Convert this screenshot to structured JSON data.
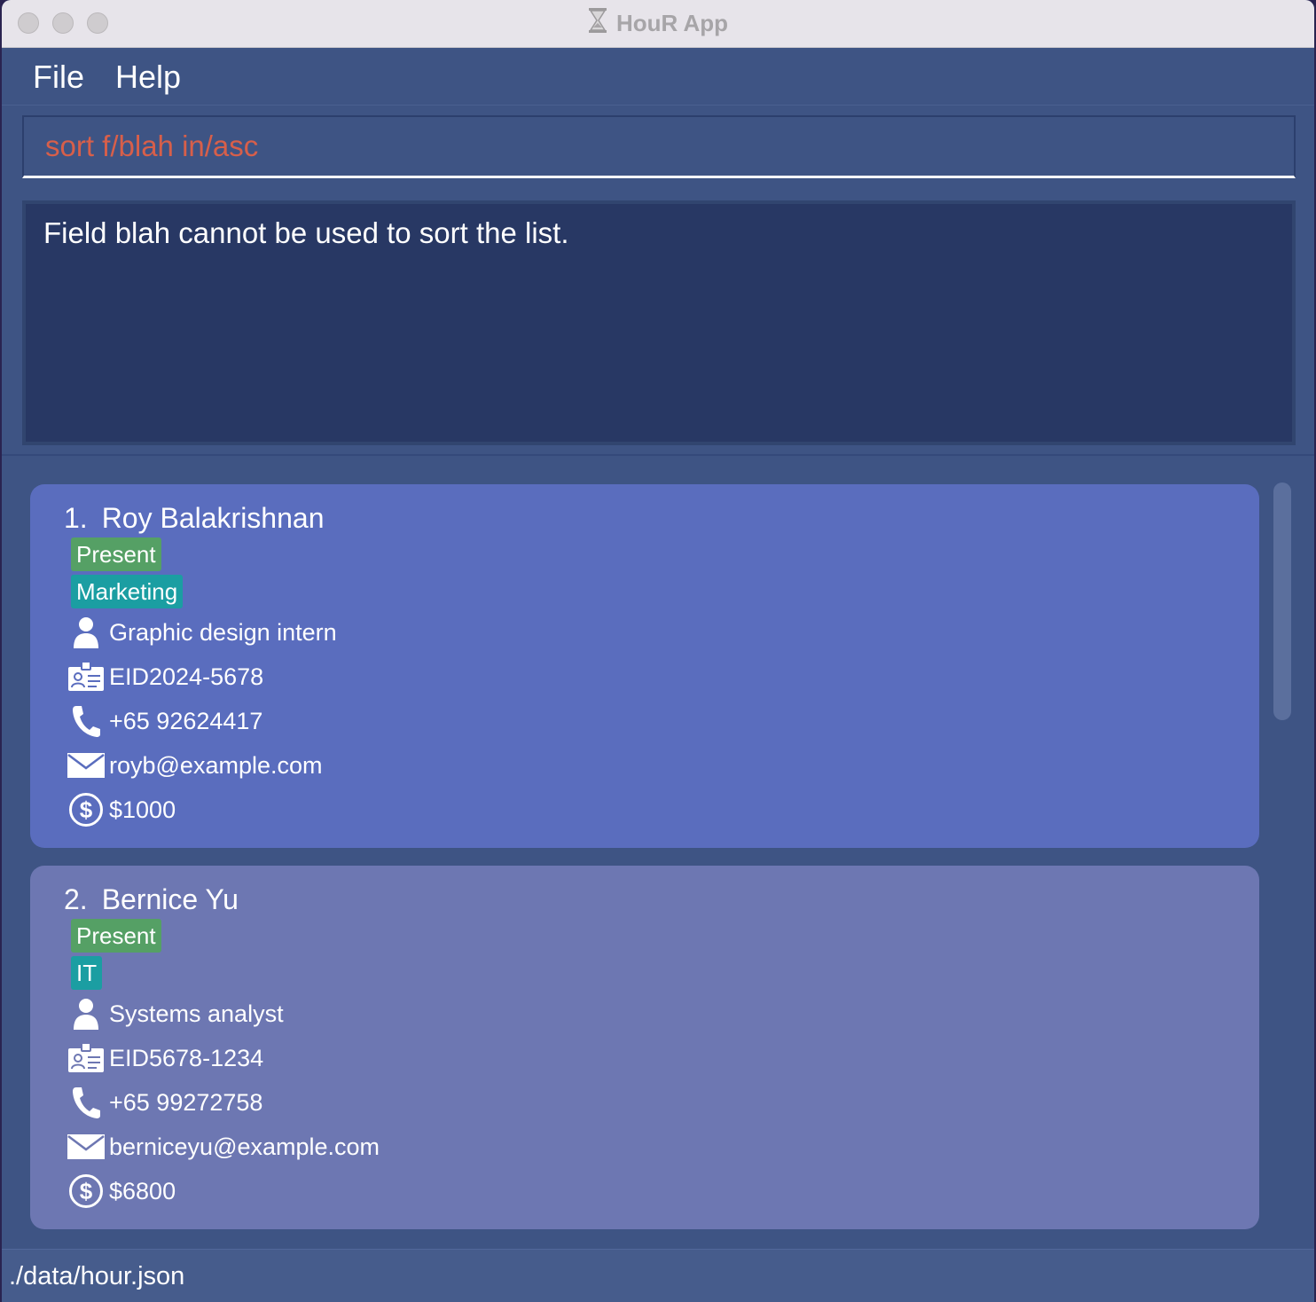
{
  "window": {
    "title": "HouR App"
  },
  "menu": {
    "file": "File",
    "help": "Help"
  },
  "command": {
    "value": "sort f/blah in/asc"
  },
  "result": {
    "message": "Field blah cannot be used to sort the list."
  },
  "employees": [
    {
      "index": "1.",
      "name": "Roy Balakrishnan",
      "status": "Present",
      "department": "Marketing",
      "role": "Graphic design intern",
      "eid": "EID2024-5678",
      "phone": "+65 92624417",
      "email": "royb@example.com",
      "salary": "$1000"
    },
    {
      "index": "2.",
      "name": "Bernice Yu",
      "status": "Present",
      "department": "IT",
      "role": "Systems analyst",
      "eid": "EID5678-1234",
      "phone": "+65 99272758",
      "email": "berniceyu@example.com",
      "salary": "$6800"
    }
  ],
  "status_bar": {
    "path": "./data/hour.json"
  },
  "colors": {
    "background": "#3e5484",
    "command_text": "#d75f4a",
    "selected_card": "#5a6dbe",
    "card": "#6d77b2",
    "status_tag": "#55a065",
    "department_tag": "#1b9ea2"
  },
  "icons": [
    "hourglass-icon",
    "person-icon",
    "id-card-icon",
    "phone-icon",
    "mail-icon",
    "dollar-icon"
  ]
}
